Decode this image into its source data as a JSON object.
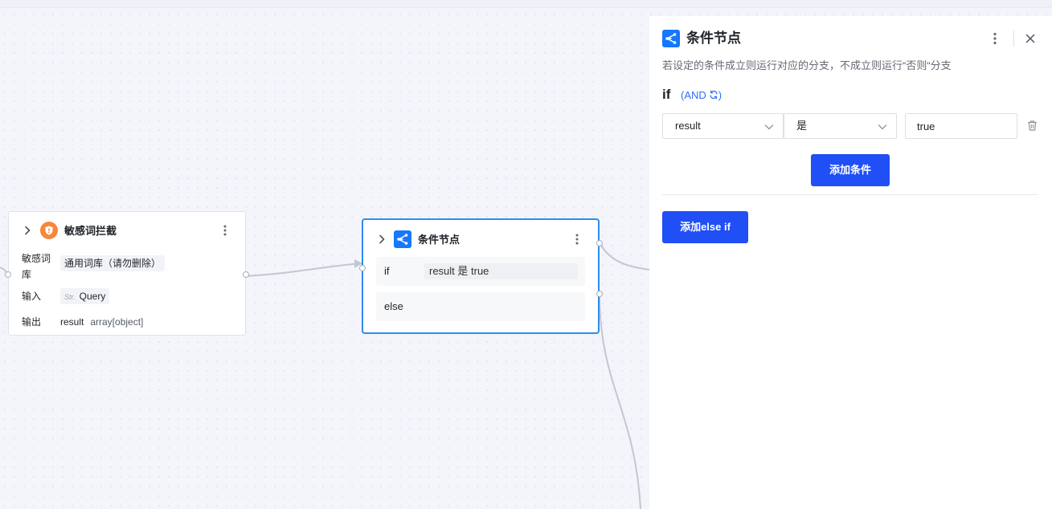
{
  "colors": {
    "accent": "#1677ff",
    "button": "#1f4ff5",
    "orange": "#f5883a",
    "selected_border": "#2d8cf0",
    "and_link": "#2d6ff7"
  },
  "node_sensitive": {
    "title": "敏感词拦截",
    "icon": "shield-icon",
    "fields": {
      "lexicon_label": "敏感词库",
      "lexicon_value": "通用词库（请勿删除）",
      "input_label": "输入",
      "input_type_badge": "Str.",
      "input_value": "Query",
      "output_label": "输出",
      "output_name": "result",
      "output_type": "array[object]"
    }
  },
  "node_condition": {
    "title": "条件节点",
    "icon": "branch-icon",
    "if_label": "if",
    "if_expression": "result 是 true",
    "else_label": "else"
  },
  "panel": {
    "title": "条件节点",
    "icon": "branch-icon",
    "description": "若设定的条件成立则运行对应的分支，不成立则运行“否则“分支",
    "if_label": "if",
    "logic_label": "(AND",
    "logic_close": ")",
    "condition": {
      "variable": "result",
      "operator": "是",
      "value": "true"
    },
    "add_condition_label": "添加条件",
    "add_else_if_label": "添加else if"
  }
}
